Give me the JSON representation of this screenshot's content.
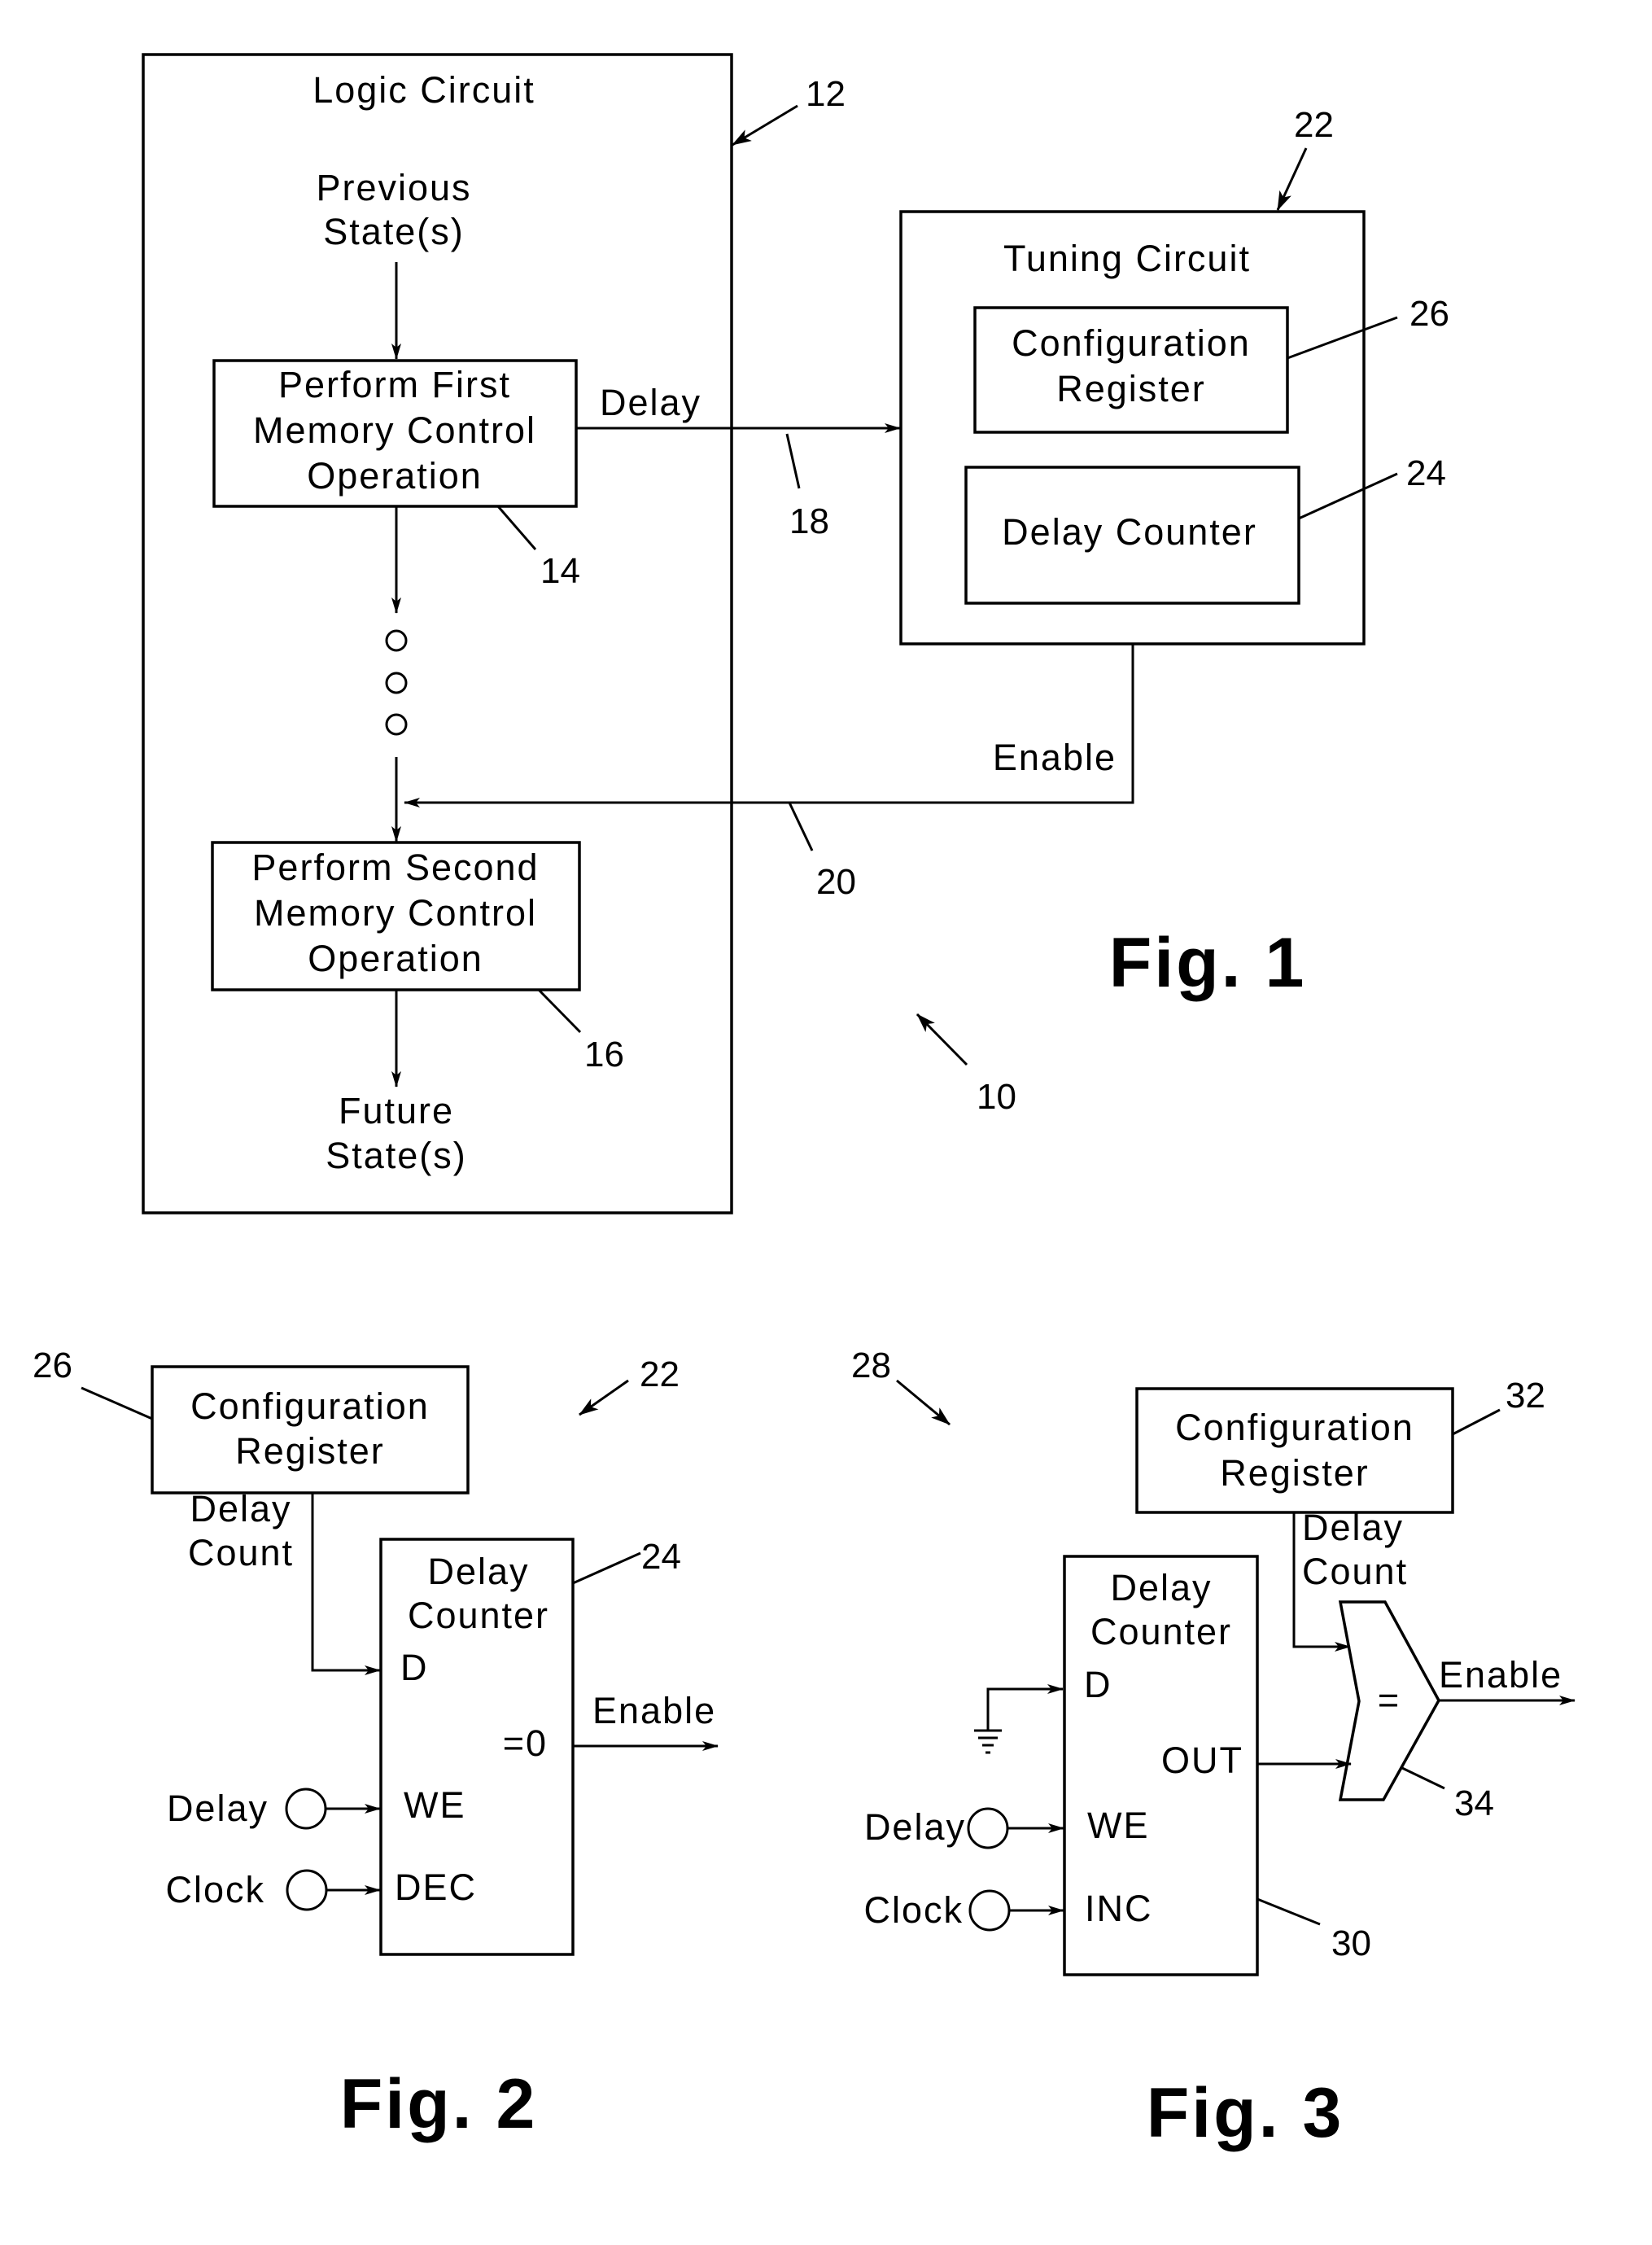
{
  "fig1": {
    "caption": "Fig. 1",
    "logic_circuit": {
      "title": "Logic Circuit",
      "ref": "12",
      "previous_states": [
        "Previous",
        "State(s)"
      ],
      "first_op": {
        "lines": [
          "Perform First",
          "Memory Control",
          "Operation"
        ],
        "ref": "14"
      },
      "second_op": {
        "lines": [
          "Perform Second",
          "Memory Control",
          "Operation"
        ],
        "ref": "16"
      },
      "future_states": [
        "Future",
        "State(s)"
      ]
    },
    "delay_signal": {
      "label": "Delay",
      "ref": "18"
    },
    "enable_signal": {
      "label": "Enable",
      "ref": "20"
    },
    "tuning_circuit": {
      "title": "Tuning Circuit",
      "ref": "22",
      "config_register": {
        "lines": [
          "Configuration",
          "Register"
        ],
        "ref": "26"
      },
      "delay_counter": {
        "label": "Delay Counter",
        "ref": "24"
      }
    },
    "system_ref": "10"
  },
  "fig2": {
    "caption": "Fig. 2",
    "ref": "22",
    "config_register": {
      "lines": [
        "Configuration",
        "Register"
      ],
      "ref": "26"
    },
    "delay_count_label": [
      "Delay",
      "Count"
    ],
    "delay_counter": {
      "title": [
        "Delay",
        "Counter"
      ],
      "ref": "24",
      "ports": {
        "d": "D",
        "we": "WE",
        "dec": "DEC",
        "zero": "=0"
      }
    },
    "inputs": {
      "delay": "Delay",
      "clock": "Clock"
    },
    "output": "Enable"
  },
  "fig3": {
    "caption": "Fig. 3",
    "ref": "28",
    "config_register": {
      "lines": [
        "Configuration",
        "Register"
      ],
      "ref": "32"
    },
    "delay_count_label": [
      "Delay",
      "Count"
    ],
    "delay_counter": {
      "title": [
        "Delay",
        "Counter"
      ],
      "ref": "30",
      "ports": {
        "d": "D",
        "we": "WE",
        "inc": "INC",
        "out": "OUT"
      }
    },
    "comparator": {
      "symbol": "=",
      "ref": "34"
    },
    "inputs": {
      "delay": "Delay",
      "clock": "Clock"
    },
    "output": "Enable"
  }
}
